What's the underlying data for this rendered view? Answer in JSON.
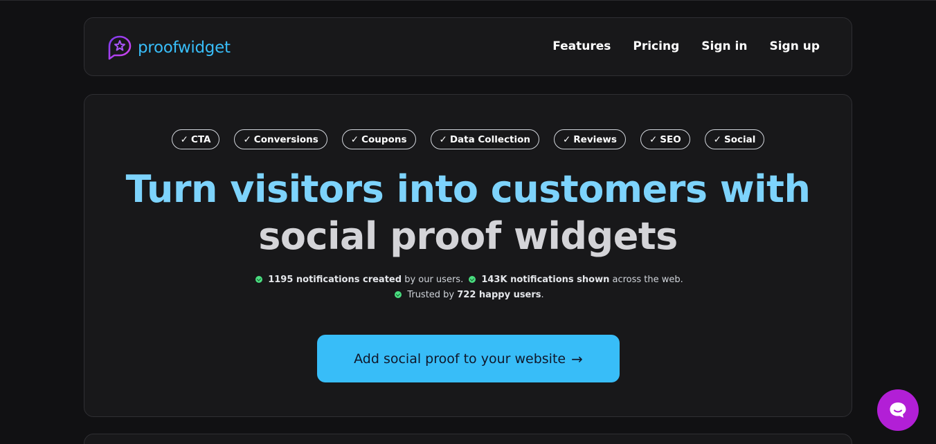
{
  "brand": {
    "name": "proofwidget",
    "logo_icon": "chat-star-icon"
  },
  "nav": {
    "links": [
      "Features",
      "Pricing",
      "Sign in",
      "Sign up"
    ]
  },
  "hero": {
    "tags": [
      "CTA",
      "Conversions",
      "Coupons",
      "Data Collection",
      "Reviews",
      "SEO",
      "Social"
    ],
    "check_glyph": "✓",
    "headline_line1": "Turn visitors into customers with",
    "headline_line2": "social proof widgets",
    "stats": {
      "notifications_created": "1195 notifications created",
      "created_suffix": "by our users.",
      "notifications_shown": "143K notifications shown",
      "shown_suffix": "across the web.",
      "trusted_prefix": "Trusted by",
      "happy_users": "722 happy users",
      "trusted_suffix": "."
    },
    "cta_label": "Add social proof to your website",
    "cta_arrow": "→"
  },
  "colors": {
    "accent": "#38bdf8",
    "headline_blue": "#7dd3fc",
    "chat_purple": "#b21fd6",
    "check_green": "#4ade80"
  },
  "chat_widget": {
    "icon": "chat-bubble-icon"
  }
}
